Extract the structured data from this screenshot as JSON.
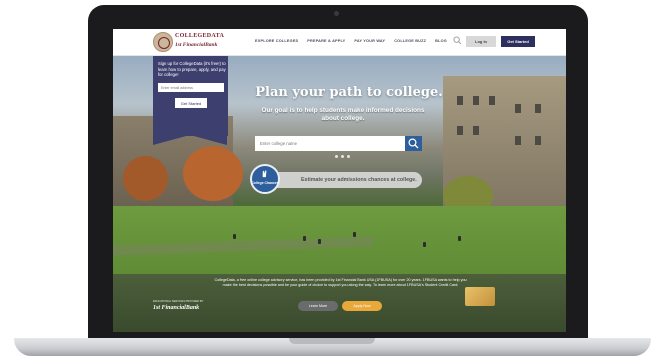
{
  "nav": {
    "logo_top": "COLLEGEDATA",
    "logo_bottom": "1st FinancialBank",
    "links": [
      "EXPLORE COLLEGES",
      "PREPARE & APPLY",
      "PAY YOUR WAY",
      "COLLEGE BUZZ",
      "BLOG"
    ],
    "login": "Log In",
    "get_started": "Get Started",
    "search_icon": "search-icon"
  },
  "signup": {
    "text": "Sign up for CollegeData (it's free!) to learn how to prepare, apply, and pay for college!",
    "placeholder": "Enter email address",
    "button": "Get Started"
  },
  "hero": {
    "headline": "Plan your path to college.",
    "subhead": "Our goal is to help students make informed decisions about college.",
    "search_placeholder": "Enter college name",
    "estimate": "Estimate your admissions chances at college.",
    "badge_text": "College Chances"
  },
  "footer": {
    "text": "CollegeData, a free online college advisory service, has been provided by 1st Financial Bank USA (1FBUSA) for over 20 years. 1FBUSA wants to help you make the best decisions possible and be your guide of choice to support you along the way. To learn more about 1FBUSA's Student Credit Card:",
    "sponsor_small": "EDUCATIONAL SERVICES PROVIDED BY",
    "sponsor_logo": "1st FinancialBank",
    "learn_more": "Learn More",
    "apply_now": "Apply Now"
  },
  "colors": {
    "navy": "#2d2f5e",
    "blue": "#2e5f9c",
    "orange": "#e8a93a",
    "maroon": "#7a1f2b"
  }
}
